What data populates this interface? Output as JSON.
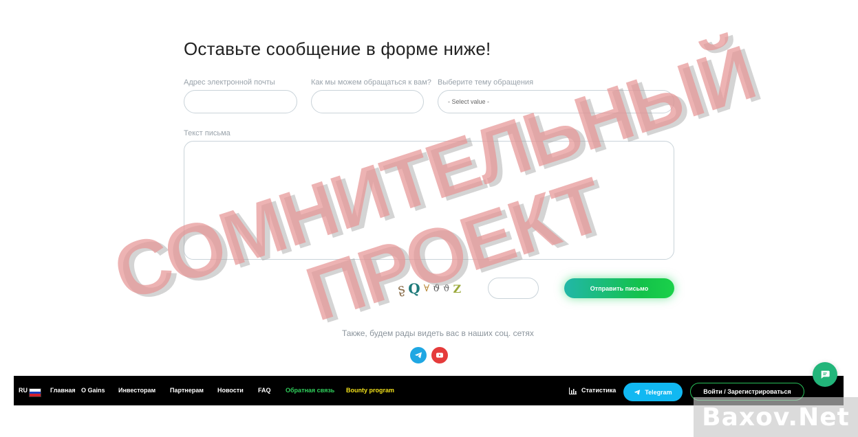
{
  "form": {
    "title": "Оставьте сообщение в форме ниже!",
    "email_label": "Адрес электронной почты",
    "email_value": "",
    "name_label": "Как мы можем обращаться к вам?",
    "name_value": "",
    "topic_label": "Выберите тему обращения",
    "topic_selected": "- Select value -",
    "message_label": "Текст письма",
    "message_value": "",
    "captcha_chars": [
      "ʂ",
      "Q",
      "∀",
      "ϑ",
      "ϑ",
      "Z"
    ],
    "captcha_value": "",
    "send_label": "Отправить письмо"
  },
  "social": {
    "text": "Также, будем рады видеть вас в наших соц. сетях",
    "icons": [
      "telegram-icon",
      "youtube-icon"
    ],
    "colors": {
      "telegram": "#1fa7e3",
      "youtube": "#e53b3b"
    }
  },
  "nav": {
    "lang": "RU",
    "items": [
      {
        "label": "Главная"
      },
      {
        "label": "O Gains"
      },
      {
        "label": "Инвесторам"
      },
      {
        "label": "Партнерам"
      },
      {
        "label": "Новости"
      },
      {
        "label": "FAQ"
      },
      {
        "label": "Обратная связь"
      },
      {
        "label": "Bounty program"
      }
    ],
    "stats_label": "Статистика",
    "telegram_label": "Telegram",
    "login_label": "Войти / Зарегистрироваться",
    "colors": {
      "active": "#30d05c",
      "bounty": "#f3e21a",
      "telegram_btn": "#11b8f2"
    }
  },
  "overlay": {
    "stamp_line1": "СОМНИТЕЛЬНЫЙ",
    "stamp_line2": "ПРОЕКТ",
    "watermark": "Baxov.Net",
    "stamp_color": "#e89494"
  }
}
